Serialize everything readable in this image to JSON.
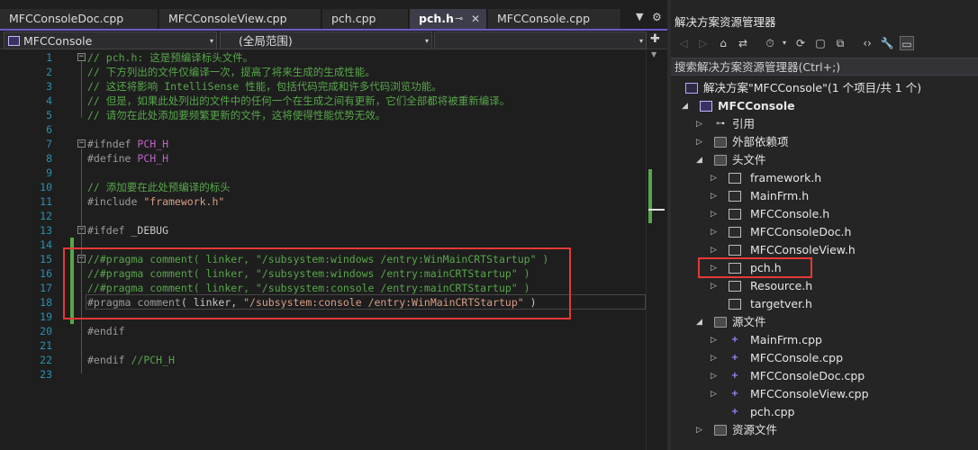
{
  "tabs": [
    {
      "label": "MFCConsoleDoc.cpp",
      "active": false
    },
    {
      "label": "MFCConsoleView.cpp",
      "active": false
    },
    {
      "label": "pch.cpp",
      "active": false
    },
    {
      "label": "pch.h",
      "active": true
    },
    {
      "label": "MFCConsole.cpp",
      "active": false
    }
  ],
  "icons": {
    "pin": "⊸",
    "close": "✕",
    "overflow": "▼",
    "settings": "⚙",
    "plus": "✚",
    "tri_down": "▾",
    "collapse": "◢",
    "expand": "▷",
    "cpp": "+",
    "back": "◁",
    "forward": "▷",
    "home": "⌂",
    "switch_view": "⇄",
    "history": "⏱",
    "sync": "⟳",
    "pages": "▢",
    "copy": "⧉",
    "code": "‹›",
    "wrench": "🔧",
    "preview": "▭"
  },
  "navbar": {
    "project": "MFCConsole",
    "scope": "(全局范围)"
  },
  "line_numbers": [
    "1",
    "2",
    "3",
    "4",
    "5",
    "6",
    "7",
    "8",
    "9",
    "10",
    "11",
    "12",
    "13",
    "14",
    "15",
    "16",
    "17",
    "18",
    "19",
    "20",
    "21",
    "22",
    "23"
  ],
  "code": {
    "l1": "// pch.h: 这是预编译标头文件。",
    "l2": "// 下方列出的文件仅编译一次，提高了将来生成的生成性能。",
    "l3": "// 这还将影响 IntelliSense 性能，包括代码完成和许多代码浏览功能。",
    "l4": "// 但是，如果此处列出的文件中的任何一个在生成之间有更新，它们全部都将被重新编译。",
    "l5": "// 请勿在此处添加要频繁更新的文件，这将使得性能优势无效。",
    "l7_pp": "#ifndef",
    "l7_id": " PCH_H",
    "l8_pp": "#define",
    "l8_id": " PCH_H",
    "l10": "// 添加要在此处预编译的标头",
    "l11_pp": "#include",
    "l11_str": " \"framework.h\"",
    "l13_pp": "#ifdef",
    "l13_id": " _DEBUG",
    "l15": "//#pragma comment( linker, \"/subsystem:windows /entry:WinMainCRTStartup\" )",
    "l16": "//#pragma comment( linker, \"/subsystem:windows /entry:mainCRTStartup\" )",
    "l17": "//#pragma comment( linker, \"/subsystem:console /entry:mainCRTStartup\" )",
    "l18_pp": "#pragma",
    "l18_kw": " comment",
    "l18_a": "( ",
    "l18_b": "linker, ",
    "l18_str": "\"/subsystem:console /entry:WinMainCRTStartup\"",
    "l18_c": " )",
    "l20_pp": "#endif",
    "l22_pp": "#endif",
    "l22_cm": " //PCH_H"
  },
  "solution_explorer": {
    "title": "解决方案资源管理器",
    "search_placeholder": "搜索解决方案资源管理器(Ctrl+;)",
    "solution": "解决方案\"MFCConsole\"(1 个项目/共 1 个)",
    "project": "MFCConsole",
    "references": "引用",
    "external_deps": "外部依赖项",
    "headers_folder": "头文件",
    "headers": [
      "framework.h",
      "MainFrm.h",
      "MFCConsole.h",
      "MFCConsoleDoc.h",
      "MFCConsoleView.h",
      "pch.h",
      "Resource.h",
      "targetver.h"
    ],
    "sources_folder": "源文件",
    "sources": [
      "MainFrm.cpp",
      "MFCConsole.cpp",
      "MFCConsoleDoc.cpp",
      "MFCConsoleView.cpp",
      "pch.cpp"
    ],
    "resources_folder": "资源文件"
  }
}
